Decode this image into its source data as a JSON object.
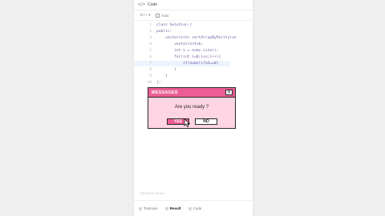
{
  "header": {
    "icon": "code-icon",
    "title": "Code"
  },
  "toolbar": {
    "language": "C++ ∨",
    "auto": "Auto"
  },
  "code_lines": [
    {
      "num": "1",
      "text": "class Solution {"
    },
    {
      "num": "2",
      "text": "public:"
    },
    {
      "num": "3",
      "text": "    vector<int> sortArrayByParity(ve"
    },
    {
      "num": "4",
      "text": "        vector<int>b;"
    },
    {
      "num": "5",
      "text": "        int n = nums.size();"
    },
    {
      "num": "6",
      "text": "        for(int i=0;i<n;i++){"
    },
    {
      "num": "7",
      "text": "            if(nums[i]%2==0)"
    },
    {
      "num": "8",
      "text": "        }"
    },
    {
      "num": "9",
      "text": "    }"
    },
    {
      "num": "10",
      "text": "};"
    }
  ],
  "editor_footer": {
    "placeholder": "Saved to cloud"
  },
  "bottom_tabs": [
    {
      "label": "Testcase",
      "active": false
    },
    {
      "label": "Result",
      "active": true
    },
    {
      "label": "Code",
      "active": false
    }
  ],
  "dialog": {
    "title": "MESSAGES",
    "message": "Are you ready ?",
    "yes_label": "YES",
    "no_label": "NO",
    "close_label": "✕"
  },
  "colors": {
    "dialog_pink": "#ffd4e3",
    "titlebar_pink": "#ec5d93",
    "keyword": "#6a5a9e"
  }
}
